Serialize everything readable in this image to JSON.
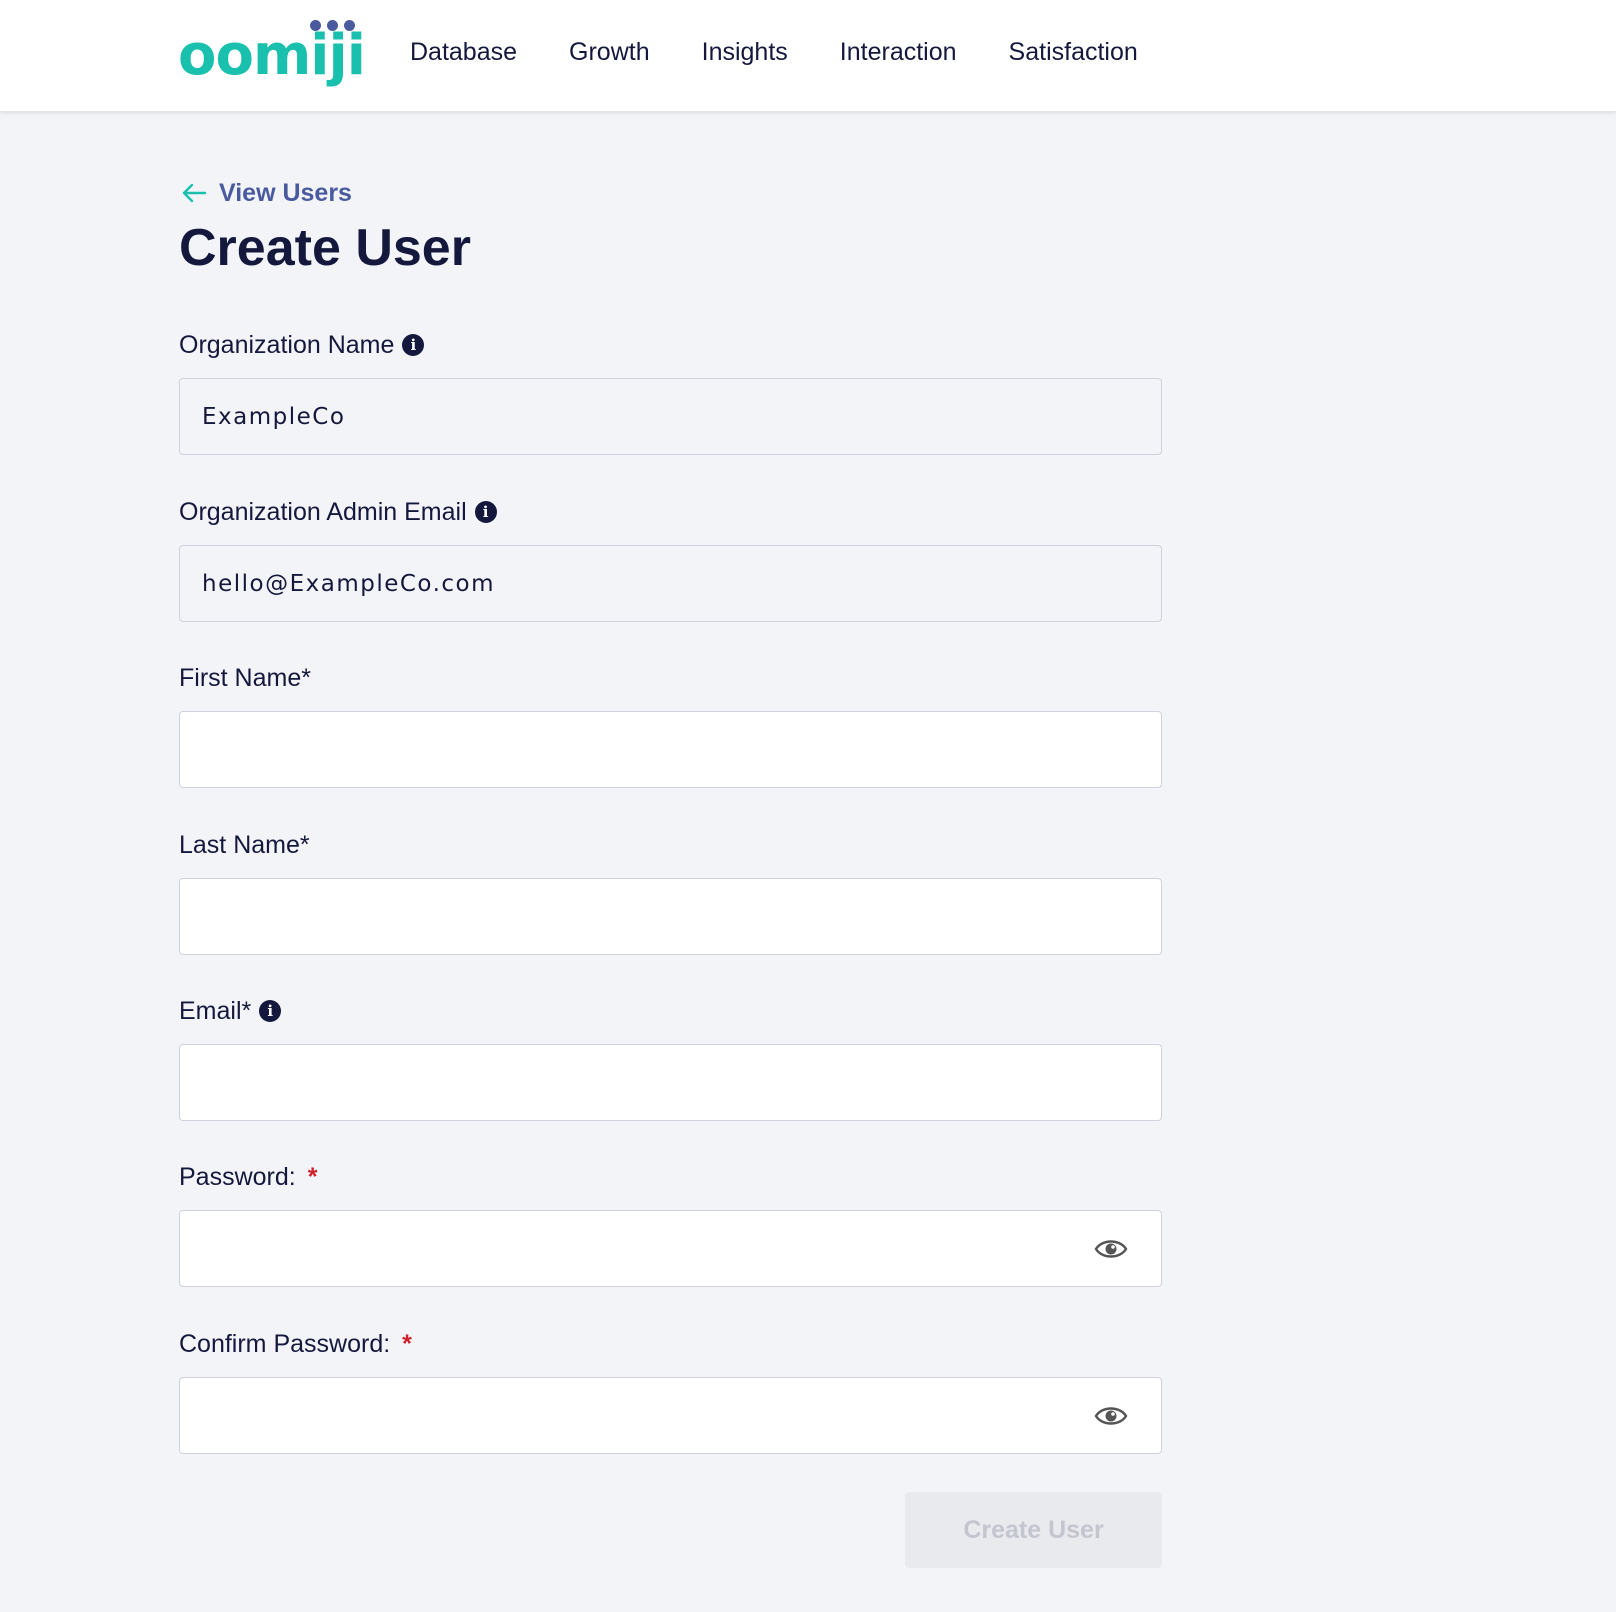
{
  "brand": {
    "logo_text": "oomiji",
    "accent": "#19c0ad",
    "dots": "#4a5a9f"
  },
  "nav": {
    "items": [
      "Database",
      "Growth",
      "Insights",
      "Interaction",
      "Satisfaction"
    ]
  },
  "back_link": {
    "label": "View Users",
    "icon": "arrow-left-icon"
  },
  "page": {
    "title": "Create User"
  },
  "form": {
    "org_name": {
      "label": "Organization Name",
      "value": "ExampleCo"
    },
    "org_admin_email": {
      "label": "Organization Admin Email",
      "value": "hello@ExampleCo.com"
    },
    "first_name": {
      "label": "First Name*",
      "value": ""
    },
    "last_name": {
      "label": "Last Name*",
      "value": ""
    },
    "email": {
      "label": "Email*",
      "value": ""
    },
    "password": {
      "label": "Password:",
      "required": "*",
      "value": ""
    },
    "confirm_password": {
      "label": "Confirm Password:",
      "required": "*",
      "value": ""
    },
    "submit_label": "Create User"
  },
  "colors": {
    "text": "#14183d",
    "background": "#f3f4f8",
    "required": "#d0202a",
    "link": "#4a5a9f"
  }
}
